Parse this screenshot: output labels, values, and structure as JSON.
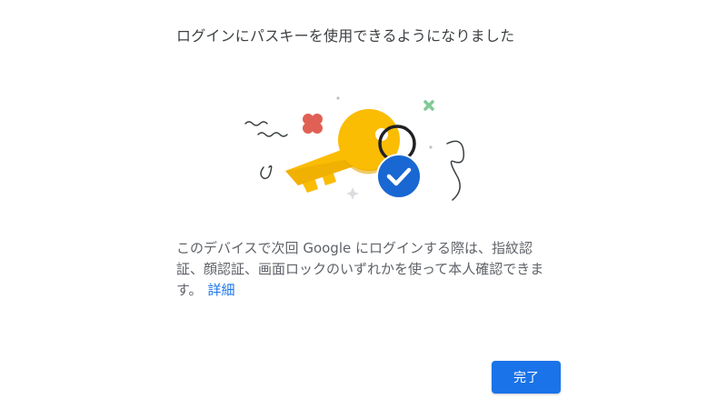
{
  "dialog": {
    "title": "ログインにパスキーを使用できるようになりました",
    "body_text": "このデバイスで次回 Google にログインする際は、指紋認証、顔認証、画面ロックのいずれかを使って本人確認できます。",
    "learn_more_label": "詳細",
    "done_label": "完了"
  },
  "illustration": {
    "name": "passkey-key-icon",
    "colors": {
      "key": "#fbbc04",
      "key_dark": "#e8a600",
      "check_badge": "#1967d2",
      "flower": "#e06055",
      "sparkle_green": "#81c995",
      "line": "#3c4043"
    }
  },
  "colors": {
    "accent": "#1a73e8",
    "title_text": "#3c4043",
    "body_text": "#5f6368"
  }
}
